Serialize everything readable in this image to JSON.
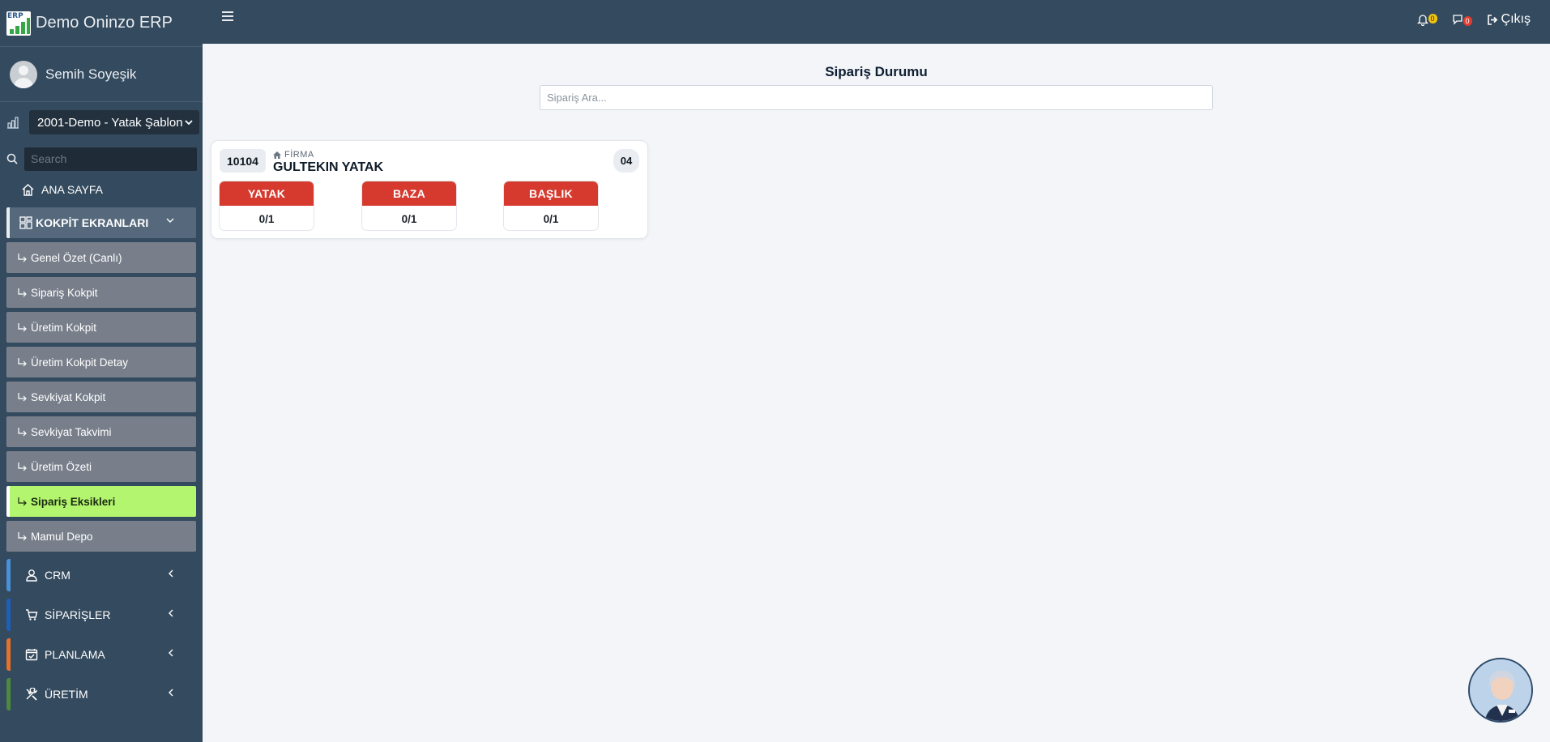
{
  "app": {
    "title": "Demo Oninzo ERP",
    "logo_text": "ERP"
  },
  "user": {
    "name": "Semih Soyeşik"
  },
  "company": {
    "selected": "2001-Demo - Yatak Şablon"
  },
  "sidebar_search": {
    "placeholder": "Search"
  },
  "nav": {
    "home": "ANA SAYFA",
    "section": "KOKPİT EKRANLARI",
    "sub_items": [
      {
        "label": "Genel Özet (Canlı)",
        "active": false
      },
      {
        "label": "Sipariş Kokpit",
        "active": false
      },
      {
        "label": "Üretim Kokpit",
        "active": false
      },
      {
        "label": "Üretim Kokpit Detay",
        "active": false
      },
      {
        "label": "Sevkiyat Kokpit",
        "active": false
      },
      {
        "label": "Sevkiyat Takvimi",
        "active": false
      },
      {
        "label": "Üretim Özeti",
        "active": false
      },
      {
        "label": "Sipariş Eksikleri",
        "active": true
      },
      {
        "label": "Mamul Depo",
        "active": false
      }
    ],
    "groups": [
      {
        "label": "CRM",
        "icon": "user-icon",
        "color": "#4a90d9"
      },
      {
        "label": "SİPARİŞLER",
        "icon": "cart-icon",
        "color": "#1e5fb8"
      },
      {
        "label": "PLANLAMA",
        "icon": "calendar-check-icon",
        "color": "#e8712a"
      },
      {
        "label": "ÜRETİM",
        "icon": "tools-icon",
        "color": "#4c8a3c"
      }
    ]
  },
  "topbar": {
    "notifications_count": "0",
    "messages_count": "0",
    "logout_label": "Çıkış"
  },
  "main": {
    "title": "Sipariş Durumu",
    "search_placeholder": "Sipariş Ara...",
    "card": {
      "order_no": "10104",
      "firma_label": "FİRMA",
      "firma_name": "GULTEKIN YATAK",
      "count": "04",
      "parts": [
        {
          "name": "YATAK",
          "value": "0/1"
        },
        {
          "name": "BAZA",
          "value": "0/1"
        },
        {
          "name": "BAŞLIK",
          "value": "0/1"
        }
      ]
    }
  },
  "colors": {
    "sidebar_bg": "#344a5e",
    "active_item": "#b4f56f",
    "part_header": "#d63a2f",
    "content_bg": "#f3f5f8"
  }
}
